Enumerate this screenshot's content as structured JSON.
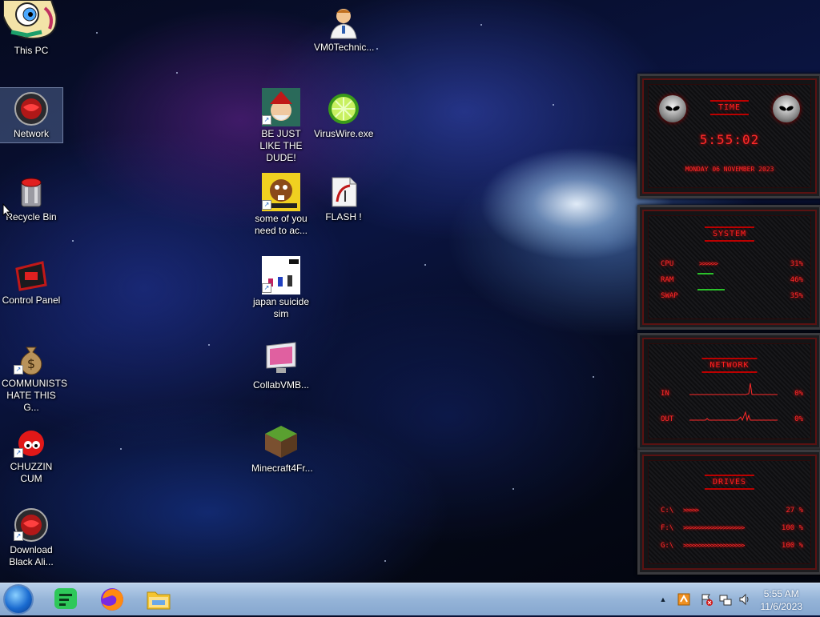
{
  "desktop_icons": [
    {
      "id": "this-pc",
      "label": "This PC"
    },
    {
      "id": "network",
      "label": "Network"
    },
    {
      "id": "recycle-bin",
      "label": "Recycle Bin"
    },
    {
      "id": "control-panel",
      "label": "Control Panel"
    },
    {
      "id": "communists",
      "label": "COMMUNISTS HATE THIS G..."
    },
    {
      "id": "chuzzin",
      "label": "CHUZZIN CUM"
    },
    {
      "id": "download-black-ali",
      "label": "Download Black Ali..."
    },
    {
      "id": "vm0technic",
      "label": "VM0Technic..."
    },
    {
      "id": "be-just-like",
      "label": "BE JUST LIKE THE DUDE!"
    },
    {
      "id": "viruswire",
      "label": "VirusWire.exe"
    },
    {
      "id": "some-of-you",
      "label": "some of you need to ac..."
    },
    {
      "id": "flash",
      "label": "FLASH !"
    },
    {
      "id": "japan-suicide-sim",
      "label": "japan suicide sim"
    },
    {
      "id": "collabvmb",
      "label": "CollabVMB..."
    },
    {
      "id": "minecraft4fr",
      "label": "Minecraft4Fr..."
    }
  ],
  "gadget": {
    "time": {
      "title": "TIME",
      "clock": "5:55:02",
      "date": "MONDAY 06 NOVEMBER 2023"
    },
    "system": {
      "title": "SYSTEM",
      "rows": [
        {
          "label": "CPU",
          "value": "31%",
          "level": 0.31
        },
        {
          "label": "RAM",
          "value": "46%",
          "level": 0.46
        },
        {
          "label": "SWAP",
          "value": "35%",
          "level": 0.35
        }
      ]
    },
    "network": {
      "title": "NETWORK",
      "rows": [
        {
          "label": "IN",
          "value": "0%"
        },
        {
          "label": "OUT",
          "value": "0%"
        }
      ]
    },
    "drives": {
      "title": "DRIVES",
      "rows": [
        {
          "label": "C:\\",
          "value": "27 %",
          "level": 0.27
        },
        {
          "label": "F:\\",
          "value": "100 %",
          "level": 1.0
        },
        {
          "label": "G:\\",
          "value": "100 %",
          "level": 1.0
        }
      ]
    }
  },
  "taskbar": {
    "time": "5:55 AM",
    "date": "11/6/2023",
    "pinned": [
      "start-orb",
      "notes-icon",
      "firefox-icon",
      "file-explorer-icon"
    ],
    "tray": [
      "show-hidden-icons",
      "tray-app-icon",
      "action-center-flag-icon",
      "network-icon",
      "volume-icon"
    ]
  }
}
